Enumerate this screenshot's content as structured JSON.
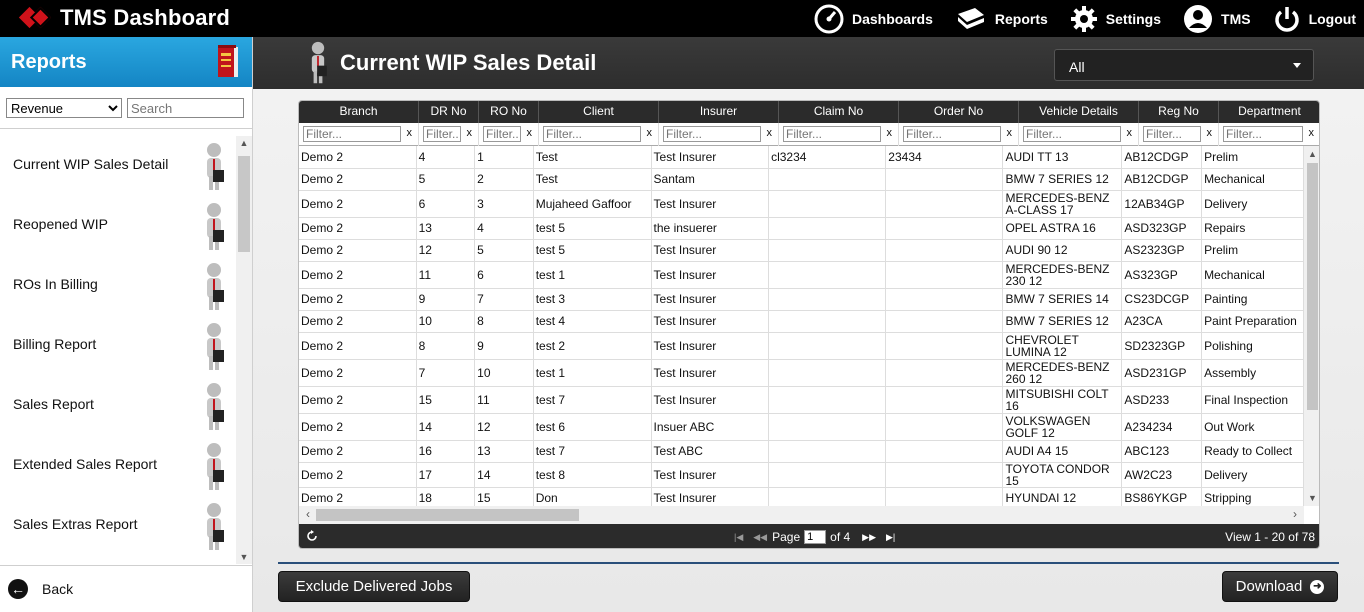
{
  "app": {
    "title": "TMS Dashboard",
    "nav": [
      {
        "label": "Dashboards",
        "icon": "speedometer-icon"
      },
      {
        "label": "Reports",
        "icon": "book-icon"
      },
      {
        "label": "Settings",
        "icon": "gear-icon"
      },
      {
        "label": "TMS",
        "icon": "user-icon"
      },
      {
        "label": "Logout",
        "icon": "power-icon"
      }
    ]
  },
  "sidebar": {
    "title": "Reports",
    "category_selected": "Revenue",
    "search_placeholder": "Search",
    "items": [
      {
        "label": "Current WIP Sales Detail"
      },
      {
        "label": "Reopened WIP"
      },
      {
        "label": "ROs In Billing"
      },
      {
        "label": "Billing Report"
      },
      {
        "label": "Sales Report"
      },
      {
        "label": "Extended Sales Report"
      },
      {
        "label": "Sales Extras Report"
      }
    ],
    "back_label": "Back"
  },
  "main": {
    "title": "Current WIP Sales Detail",
    "branch_selected": "All"
  },
  "grid": {
    "filter_placeholder": "Filter...",
    "columns": [
      "Branch",
      "DR No",
      "RO No",
      "Client",
      "Insurer",
      "Claim No",
      "Order No",
      "Vehicle Details",
      "Reg No",
      "Department"
    ],
    "rows": [
      [
        "Demo 2",
        "4",
        "1",
        "Test",
        "Test Insurer",
        "cl3234",
        "23434",
        "AUDI TT 13",
        "AB12CDGP",
        "Prelim"
      ],
      [
        "Demo 2",
        "5",
        "2",
        "Test",
        "Santam",
        "",
        "",
        "BMW 7 SERIES 12",
        "AB12CDGP",
        "Mechanical"
      ],
      [
        "Demo 2",
        "6",
        "3",
        "Mujaheed Gaffoor",
        "Test Insurer",
        "",
        "",
        "MERCEDES-BENZ A-CLASS 17",
        "12AB34GP",
        "Delivery"
      ],
      [
        "Demo 2",
        "13",
        "4",
        "test 5",
        "the insuerer",
        "",
        "",
        "OPEL ASTRA 16",
        "ASD323GP",
        "Repairs"
      ],
      [
        "Demo 2",
        "12",
        "5",
        "test 5",
        "Test Insurer",
        "",
        "",
        "AUDI 90 12",
        "AS2323GP",
        "Prelim"
      ],
      [
        "Demo 2",
        "11",
        "6",
        "test 1",
        "Test Insurer",
        "",
        "",
        "MERCEDES-BENZ 230 12",
        "AS323GP",
        "Mechanical"
      ],
      [
        "Demo 2",
        "9",
        "7",
        "test 3",
        "Test Insurer",
        "",
        "",
        "BMW 7 SERIES 14",
        "CS23DCGP",
        "Painting"
      ],
      [
        "Demo 2",
        "10",
        "8",
        "test 4",
        "Test Insurer",
        "",
        "",
        "BMW 7 SERIES 12",
        "A23CA",
        "Paint Preparation"
      ],
      [
        "Demo 2",
        "8",
        "9",
        "test 2",
        "Test Insurer",
        "",
        "",
        "CHEVROLET LUMINA 12",
        "SD2323GP",
        "Polishing"
      ],
      [
        "Demo 2",
        "7",
        "10",
        "test 1",
        "Test Insurer",
        "",
        "",
        "MERCEDES-BENZ 260 12",
        "ASD231GP",
        "Assembly"
      ],
      [
        "Demo 2",
        "15",
        "11",
        "test 7",
        "Test Insurer",
        "",
        "",
        "MITSUBISHI COLT 16",
        "ASD233",
        "Final Inspection"
      ],
      [
        "Demo 2",
        "14",
        "12",
        "test 6",
        "Insuer ABC",
        "",
        "",
        "VOLKSWAGEN GOLF 12",
        "A234234",
        "Out Work"
      ],
      [
        "Demo 2",
        "16",
        "13",
        "test 7",
        "Test ABC",
        "",
        "",
        "AUDI A4 15",
        "ABC123",
        "Ready to Collect"
      ],
      [
        "Demo 2",
        "17",
        "14",
        "test 8",
        "Test Insurer",
        "",
        "",
        "TOYOTA CONDOR 15",
        "AW2C23",
        "Delivery"
      ],
      [
        "Demo 2",
        "18",
        "15",
        "Don",
        "Test Insurer",
        "",
        "",
        "HYUNDAI 12",
        "BS86YKGP",
        "Stripping"
      ]
    ]
  },
  "pager": {
    "page_label": "Page",
    "page_value": "1",
    "of_label": "of 4",
    "view_text": "View 1 - 20 of 78"
  },
  "actions": {
    "exclude_label": "Exclude Delivered Jobs",
    "download_label": "Download"
  },
  "colors": {
    "topbar": "#000000",
    "sidebar_header": "#1f97d5",
    "grid_header": "#2b2b2b",
    "brand_red": "#d0121a"
  }
}
